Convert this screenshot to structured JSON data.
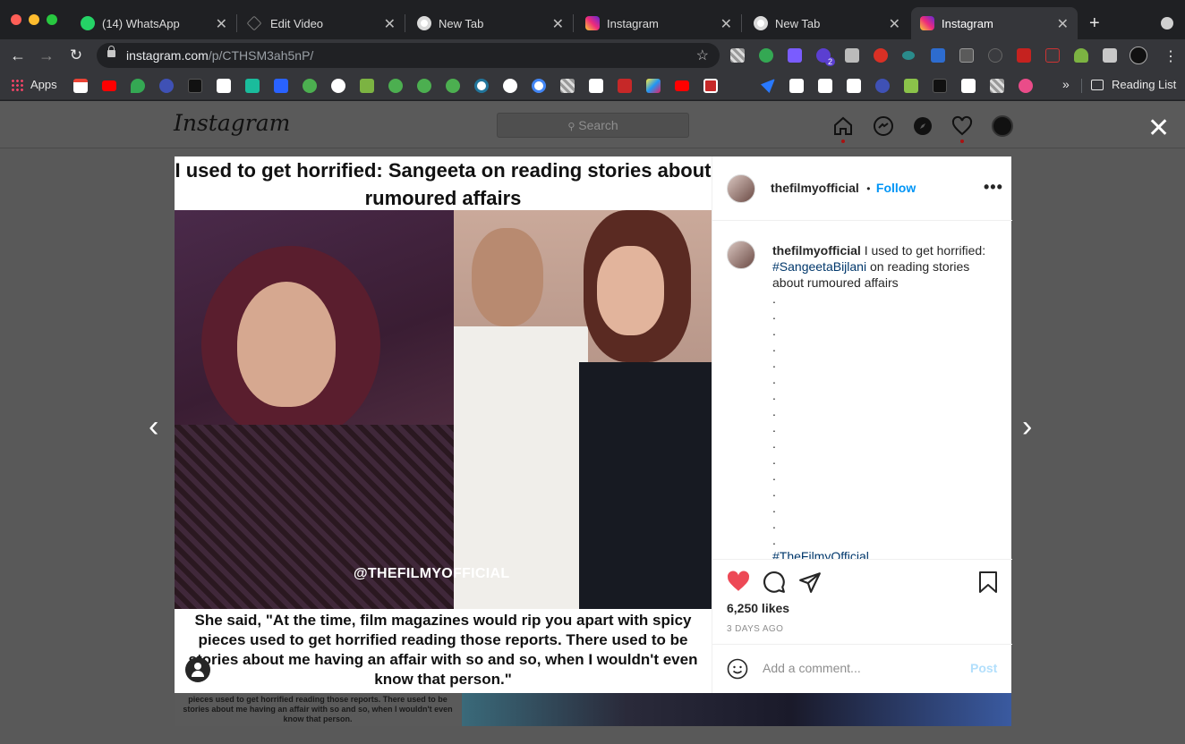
{
  "browser": {
    "tabs": [
      {
        "title": "(14) WhatsApp",
        "favicon": "whatsapp-icon",
        "color": "#25d366"
      },
      {
        "title": "Edit Video",
        "favicon": "edit-video-icon",
        "color": "#3c3c3c"
      },
      {
        "title": "New Tab",
        "favicon": "chrome-icon",
        "color": "#ffffff"
      },
      {
        "title": "Instagram",
        "favicon": "instagram-icon",
        "color": "#e1306c"
      },
      {
        "title": "New Tab",
        "favicon": "chrome-icon",
        "color": "#ffffff"
      },
      {
        "title": "Instagram",
        "favicon": "instagram-icon",
        "color": "#e1306c",
        "active": true
      }
    ],
    "url_host": "instagram.com",
    "url_path": "/p/CTHSM3ah5nP/",
    "apps_label": "Apps",
    "reading_list_label": "Reading List",
    "extension_badge": "2"
  },
  "instagram": {
    "logo": "Instagram",
    "search_placeholder": "Search",
    "post": {
      "headline": "I used to get horrified: Sangeeta on reading stories about rumoured affairs",
      "watermark": "@THEFILMYOFFICIAL",
      "quote": "She said, \"At the time, film magazines would rip you apart with spicy pieces used to get horrified reading those reports. There used to be stories about me having an affair with so and so, when I wouldn't even know that person.\"",
      "username": "thefilmyofficial",
      "follow_separator": "•",
      "follow_label": "Follow",
      "more_label": "•••",
      "caption_user": "thefilmyofficial",
      "caption_text_1": "I used to get horrified:",
      "caption_hashtag": "#SangeetaBijlani",
      "caption_text_2": "on reading stories about rumoured affairs",
      "caption_dots": [
        ".",
        ".",
        ".",
        ".",
        ".",
        ".",
        ".",
        ".",
        ".",
        ".",
        ".",
        ".",
        ".",
        ".",
        ".",
        "."
      ],
      "caption_tail_hashtag": "#TheFilmyOfficial",
      "likes": "6,250 likes",
      "date": "3 DAYS AGO",
      "comment_placeholder": "Add a comment...",
      "post_label": "Post"
    },
    "background_peek_text": "pieces used to get horrified reading those reports. There used to be stories about me having an affair with so and so, when I wouldn't even know that person."
  },
  "colors": {
    "accent_blue": "#0095f6",
    "like_red": "#ed4956",
    "hashtag_blue": "#00376b"
  }
}
